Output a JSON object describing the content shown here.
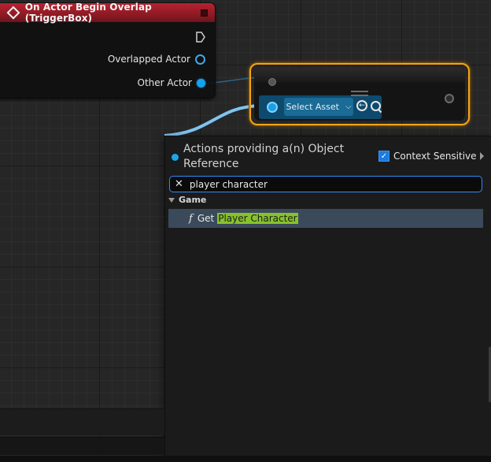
{
  "event_node": {
    "title": "On Actor Begin Overlap (TriggerBox)",
    "pins": [
      {
        "label": "Overlapped Actor"
      },
      {
        "label": "Other Actor"
      }
    ],
    "color": "#b52330"
  },
  "selected_node": {
    "asset_combo_label": "Select Asset",
    "highlight_color": "#f3a315"
  },
  "action_menu": {
    "title": "Actions providing a(n) Object Reference",
    "context_sensitive_label": "Context Sensitive",
    "context_sensitive_checked": true,
    "search_value": "player character",
    "category": "Game",
    "results": [
      {
        "prefix": "Get",
        "match": "Player Character"
      }
    ]
  },
  "colors": {
    "object_pin": "#14a3ef",
    "match_highlight": "#86c32a",
    "search_border": "#2f8cff"
  }
}
